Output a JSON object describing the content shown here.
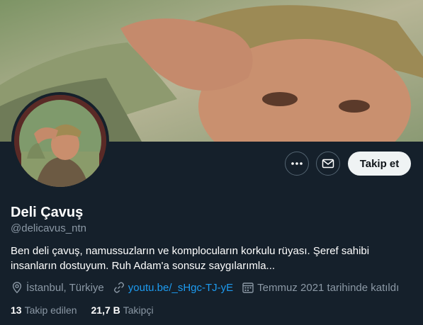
{
  "profile": {
    "name": "Deli Çavuş",
    "handle": "@delicavus_ntn",
    "bio": "Ben deli çavuş, namussuzların ve komplocuların korkulu rüyası. Şeref sahibi insanların dostuyum. Ruh Adam'a sonsuz saygılarımla...",
    "location": "İstanbul, Türkiye",
    "website": "youtu.be/_sHgc-TJ-yE",
    "joined": "Temmuz 2021 tarihinde katıldı"
  },
  "actions": {
    "follow_label": "Takip et",
    "more_icon": "more-icon",
    "message_icon": "envelope-icon"
  },
  "stats": {
    "following_count": "13",
    "following_label": "Takip edilen",
    "followers_count": "21,7 B",
    "followers_label": "Takipçi"
  },
  "icons": {
    "location": "location-pin-icon",
    "link": "link-icon",
    "calendar": "calendar-icon"
  },
  "colors": {
    "background": "#15202b",
    "accent_link": "#1d9bf0",
    "muted_text": "#8b98a5",
    "follow_button_bg": "#eff3f4"
  }
}
